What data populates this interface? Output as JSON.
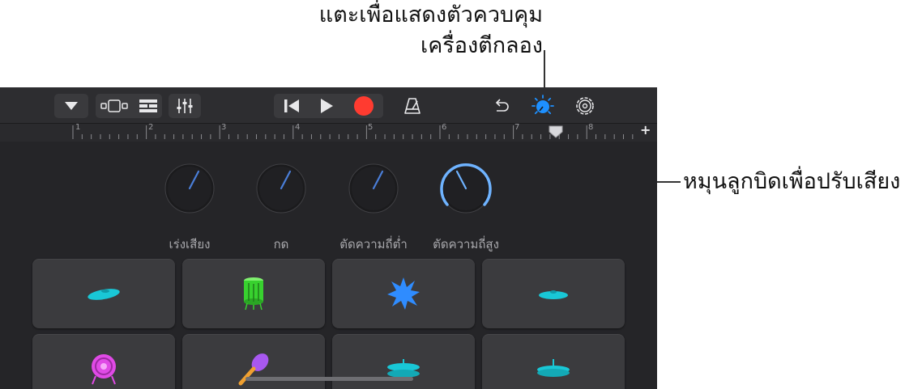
{
  "callouts": {
    "drum_controls_line1": "แตะเพื่อแสดงตัวควบคุม",
    "drum_controls_line2": "เครื่องตีกลอง",
    "knob_hint": "หมุนลูกบิดเพื่อปรับเสียง"
  },
  "toolbar": {
    "icons": [
      "browser-dropdown-icon",
      "tracks-view-icon",
      "track-list-icon",
      "mixer-icon",
      "go-to-beginning-icon",
      "play-icon",
      "record-icon",
      "metronome-icon",
      "undo-icon",
      "drum-controls-icon",
      "settings-icon"
    ],
    "colors": {
      "record": "#ff3b30",
      "drum_controls_active": "#1e90ff"
    }
  },
  "ruler": {
    "marks": [
      "1",
      "2",
      "3",
      "4",
      "5",
      "6",
      "7",
      "8"
    ],
    "add_label": "+"
  },
  "knobs": [
    {
      "label": "เร่งเสียง"
    },
    {
      "label": "กด"
    },
    {
      "label": "ตัดความถี่ต่ำ"
    },
    {
      "label": "ตัดความถี่สูง"
    }
  ],
  "pads": {
    "icons": [
      "splash-cymbal-icon",
      "snare-drum-icon",
      "crash-burst-icon",
      "ride-cymbal-icon",
      "bass-drum-icon",
      "maraca-icon",
      "hihat-open-icon",
      "hihat-closed-icon"
    ],
    "colors": {
      "cyan": "#19c7d6",
      "green": "#38d12f",
      "blue": "#2f8cff",
      "magenta": "#e04ae6",
      "purple": "#a858f0"
    }
  }
}
